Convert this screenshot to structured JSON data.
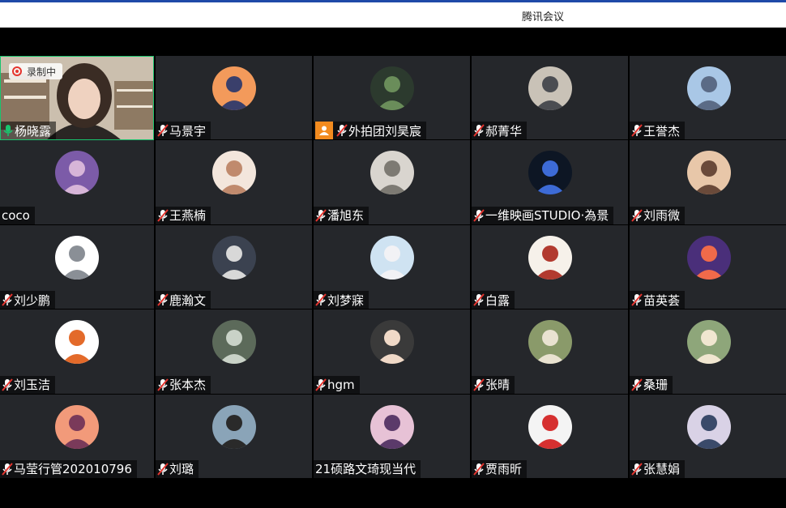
{
  "window": {
    "title": "腾讯会议"
  },
  "recording": {
    "label": "录制中"
  },
  "colors": {
    "active_border": "#19c46e",
    "muted_mic": "#e5352f",
    "share_badge": "#f28b1f"
  },
  "participants": [
    {
      "name": "杨晓露",
      "mic": "active",
      "video": true
    },
    {
      "name": "马景宇",
      "mic": "muted"
    },
    {
      "name": "外拍团刘昊宸",
      "mic": "muted",
      "badge": "share-icon"
    },
    {
      "name": "郝菁华",
      "mic": "muted"
    },
    {
      "name": "王誉杰",
      "mic": "muted"
    },
    {
      "name": "coco",
      "mic": "none"
    },
    {
      "name": "王燕楠",
      "mic": "muted"
    },
    {
      "name": "潘旭东",
      "mic": "muted"
    },
    {
      "name": "一维映画STUDIO·為景",
      "mic": "muted"
    },
    {
      "name": "刘雨微",
      "mic": "muted"
    },
    {
      "name": "刘少鹏",
      "mic": "muted"
    },
    {
      "name": "鹿瀚文",
      "mic": "muted"
    },
    {
      "name": "刘梦寐",
      "mic": "muted"
    },
    {
      "name": "白露",
      "mic": "muted"
    },
    {
      "name": "苗英荟",
      "mic": "muted"
    },
    {
      "name": "刘玉洁",
      "mic": "muted"
    },
    {
      "name": "张本杰",
      "mic": "muted"
    },
    {
      "name": "hgm",
      "mic": "muted"
    },
    {
      "name": "张晴",
      "mic": "muted"
    },
    {
      "name": "桑珊",
      "mic": "muted"
    },
    {
      "name": "马莹行管202010796",
      "mic": "muted"
    },
    {
      "name": "刘璐",
      "mic": "muted"
    },
    {
      "name": "21硕路文琦现当代",
      "mic": "none"
    },
    {
      "name": "贾雨昕",
      "mic": "muted"
    },
    {
      "name": "张慧娟",
      "mic": "muted"
    }
  ]
}
